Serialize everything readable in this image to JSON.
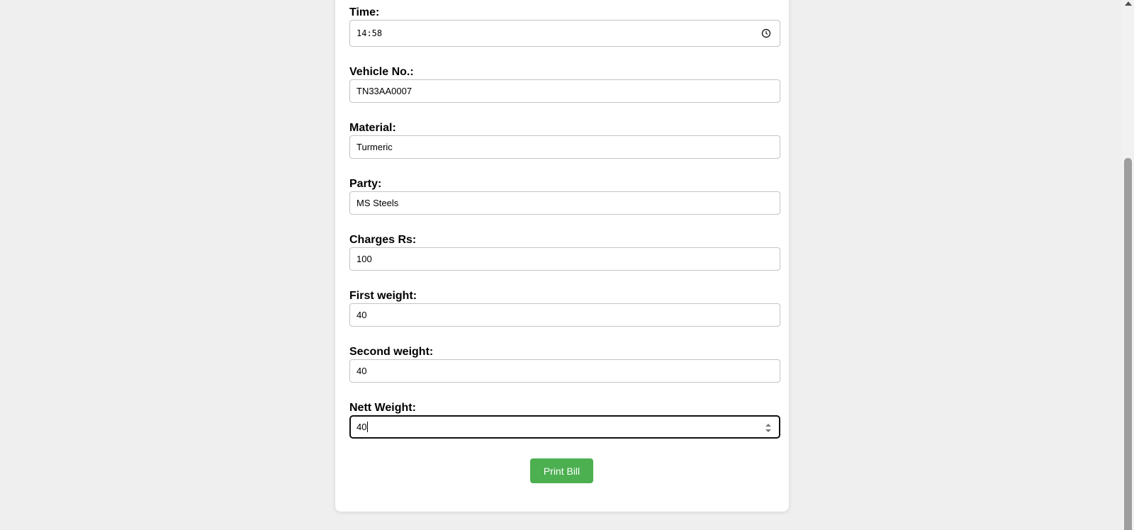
{
  "form": {
    "time": {
      "label": "Time:",
      "value": "14:58"
    },
    "vehicle_no": {
      "label": "Vehicle No.:",
      "value": "TN33AA0007"
    },
    "material": {
      "label": "Material:",
      "value": "Turmeric"
    },
    "party": {
      "label": "Party:",
      "value": "MS Steels"
    },
    "charges": {
      "label": "Charges Rs:",
      "value": "100"
    },
    "first_weight": {
      "label": "First weight:",
      "value": "40"
    },
    "second_weight": {
      "label": "Second weight:",
      "value": "40"
    },
    "nett_weight": {
      "label": "Nett Weight:",
      "value": "40"
    }
  },
  "actions": {
    "print_label": "Print Bill"
  },
  "icons": {
    "time_picker": "clock-icon",
    "number_spinner": "spinner-icon",
    "scroll_up": "scroll-up-arrow-icon"
  },
  "colors": {
    "page_background": "#efefef",
    "card_background": "#ffffff",
    "primary_button": "#4caf50",
    "focus_border": "#111111",
    "input_border": "#c4c4c4"
  }
}
